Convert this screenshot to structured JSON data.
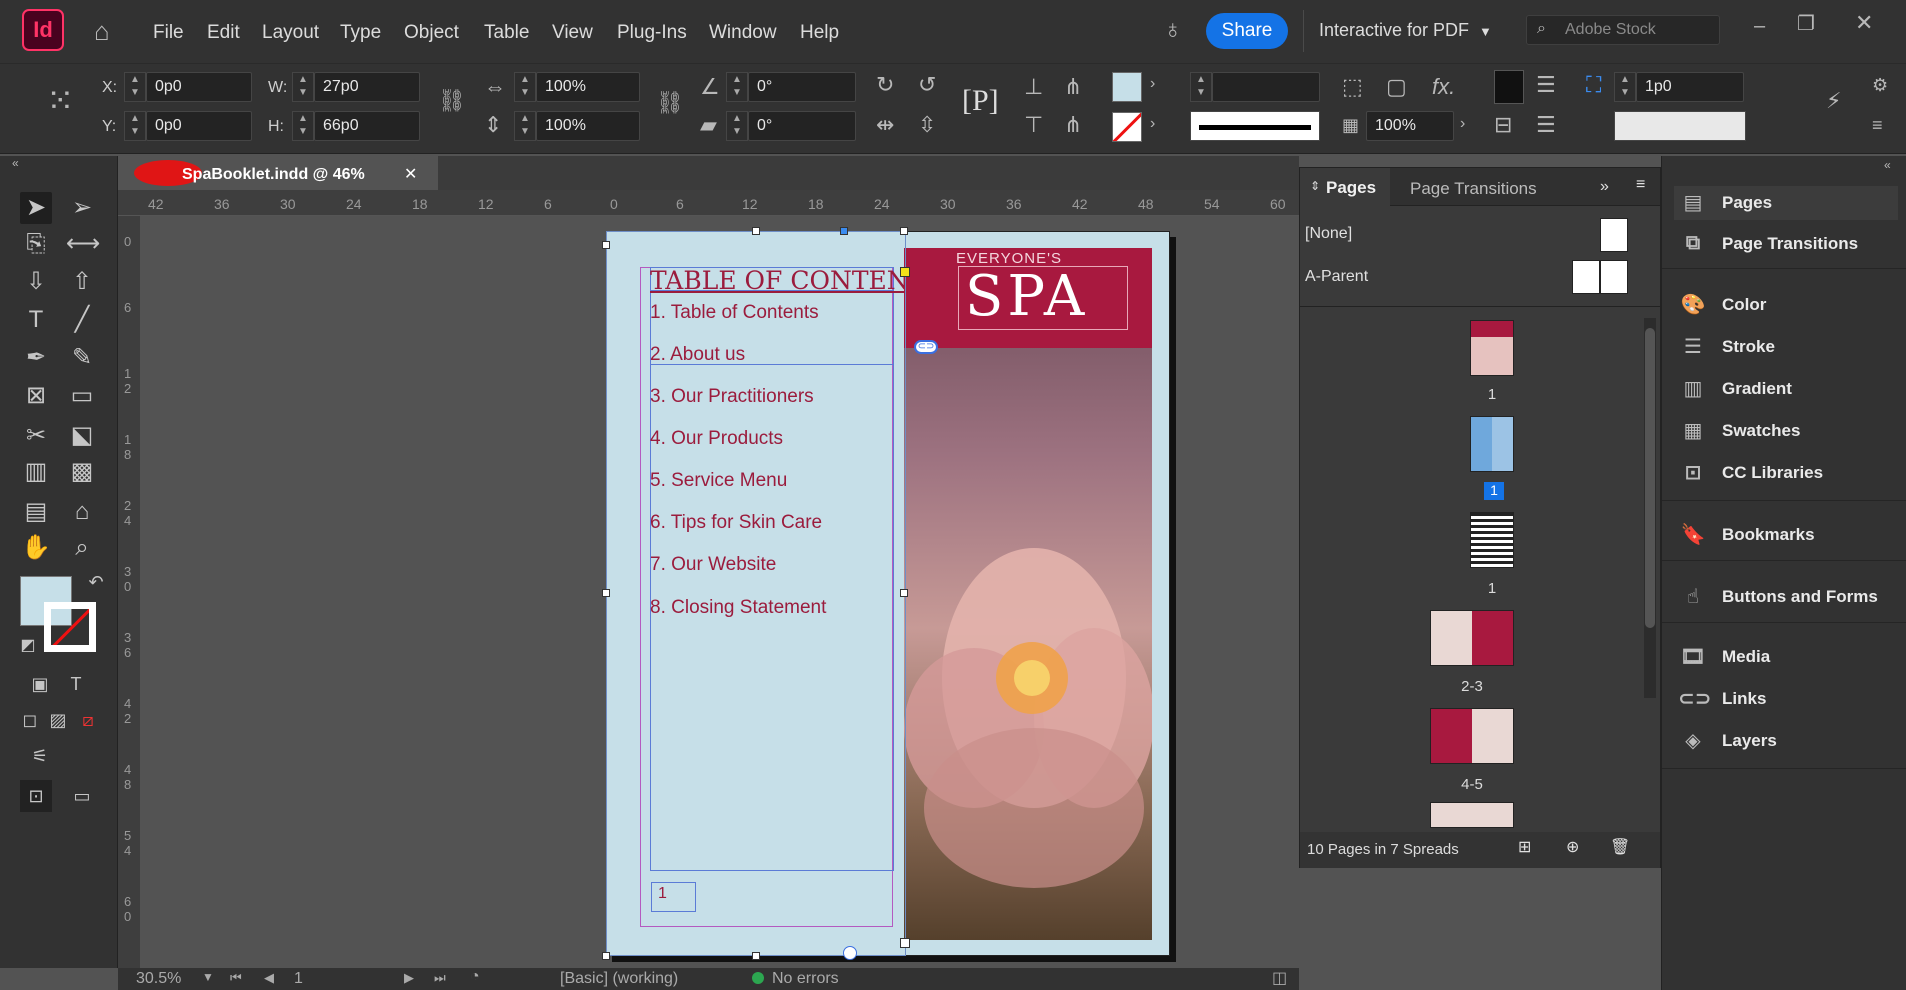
{
  "app": {
    "logo": "Id",
    "menu": [
      "File",
      "Edit",
      "Layout",
      "Type",
      "Object",
      "Table",
      "View",
      "Plug-Ins",
      "Window",
      "Help"
    ],
    "share_label": "Share",
    "workspace": "Interactive for PDF",
    "stock_placeholder": "Adobe Stock"
  },
  "control": {
    "x_label": "X:",
    "x_value": "0p0",
    "y_label": "Y:",
    "y_value": "0p0",
    "w_label": "W:",
    "w_value": "27p0",
    "h_label": "H:",
    "h_value": "66p0",
    "scale_x": "100%",
    "scale_y": "100%",
    "rotate": "0°",
    "shear": "0°",
    "opacity": "100%",
    "stroke_weight": "1p0"
  },
  "document": {
    "tab_title": "SpaBooklet.indd @ 46%",
    "ruler_top": [
      "42",
      "36",
      "30",
      "24",
      "18",
      "12",
      "6",
      "0",
      "6",
      "12",
      "18",
      "24",
      "30",
      "36",
      "42",
      "48",
      "54",
      "60"
    ],
    "ruler_left": [
      "0",
      "6",
      "1 2",
      "1 8",
      "2 4",
      "3 0",
      "3 6",
      "4 2",
      "4 8",
      "5 4",
      "6 0"
    ]
  },
  "page_content": {
    "toc_title": "TABLE OF CONTENTS",
    "toc_items": [
      "1. Table of Contents",
      "2. About us",
      "3. Our Practitioners",
      "4. Our Products",
      "5. Service Menu",
      "6. Tips for Skin Care",
      "7. Our Website",
      "8. Closing Statement"
    ],
    "cover_kicker": "EVERYONE'S",
    "cover_title": "SPA",
    "page_number_box": "1"
  },
  "status": {
    "zoom": "30.5%",
    "page": "1",
    "profile": "[Basic] (working)",
    "errors": "No errors"
  },
  "pages_panel": {
    "tab_pages": "Pages",
    "tab_transitions": "Page Transitions",
    "parent_none": "[None]",
    "parent_a": "A-Parent",
    "thumb_labels": [
      "1",
      "1",
      "1",
      "2-3",
      "4-5"
    ],
    "footer": "10 Pages in 7 Spreads"
  },
  "right_panel": {
    "items": [
      "Pages",
      "Page Transitions",
      "Color",
      "Stroke",
      "Gradient",
      "Swatches",
      "CC Libraries",
      "Bookmarks",
      "Buttons and Forms",
      "Media",
      "Links",
      "Layers"
    ]
  },
  "colors": {
    "accent": "#1473e6",
    "brand": "#ff3366",
    "toc": "#9b1c3d",
    "cover": "#a8193f",
    "page_bg": "#c6dfe8"
  }
}
